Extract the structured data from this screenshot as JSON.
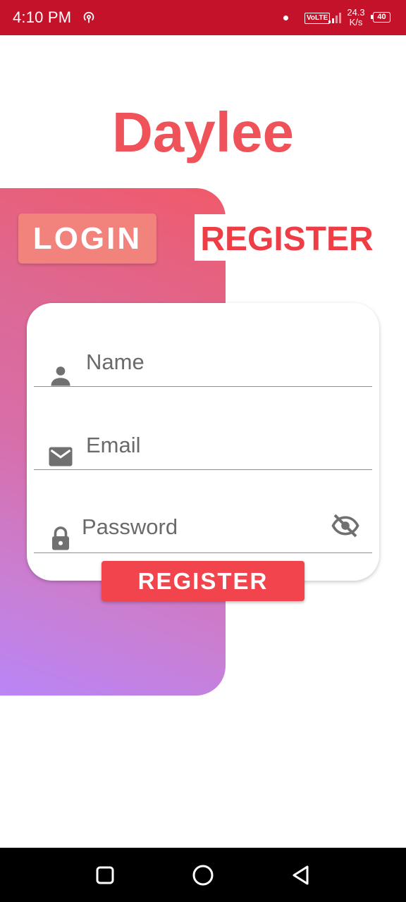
{
  "status_bar": {
    "time": "4:10 PM",
    "volte": "VoLTE",
    "net_speed_value": "24.3",
    "net_speed_unit": "K/s",
    "battery": "40",
    "icons": [
      "hotspot-icon",
      "dot-icon",
      "volte-icon",
      "signal-icon",
      "battery-icon"
    ],
    "background": "#c4122a"
  },
  "app": {
    "title": "Daylee",
    "title_color": "#f0525a"
  },
  "tabs": {
    "login_label": "LOGIN",
    "register_label": "REGISTER",
    "active": "register"
  },
  "form": {
    "name_placeholder": "Name",
    "email_placeholder": "Email",
    "password_placeholder": "Password",
    "name_icon": "person-icon",
    "email_icon": "mail-icon",
    "password_icon": "lock-icon",
    "password_toggle_icon": "eye-off-icon",
    "submit_label": "REGISTER",
    "submit_color": "#f2444c"
  },
  "gradient": {
    "top_color": "#f05a6a",
    "bottom_color": "#b985f6"
  },
  "nav_bar": {
    "icons": [
      "recent-apps-icon",
      "home-icon",
      "back-icon"
    ]
  }
}
